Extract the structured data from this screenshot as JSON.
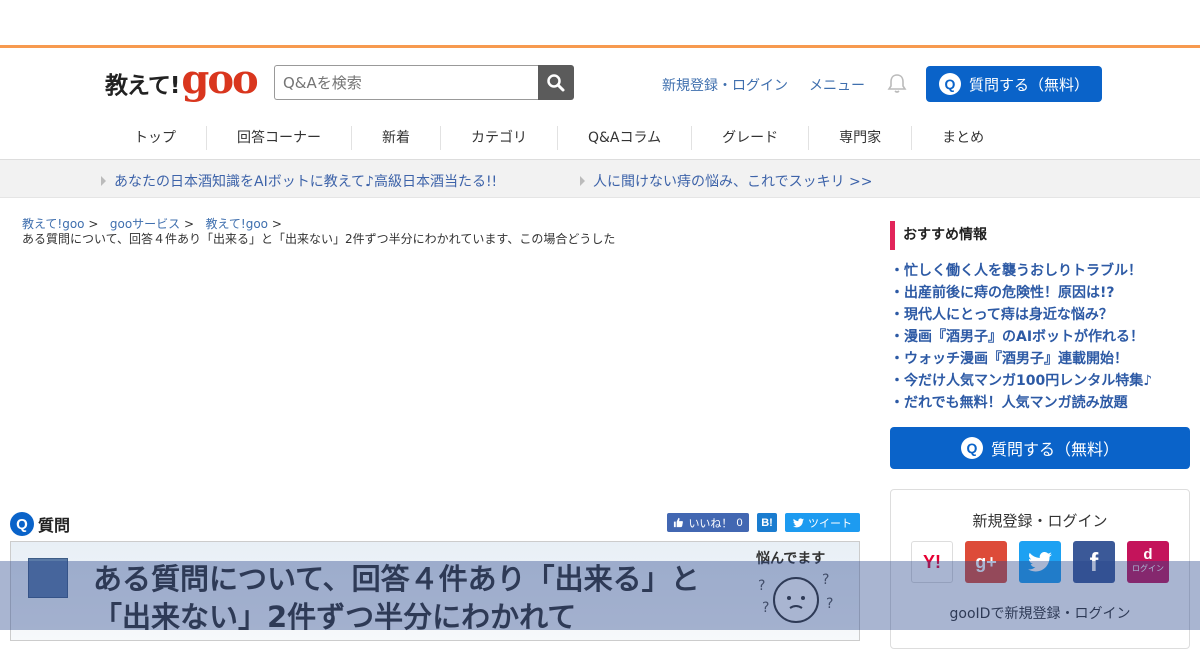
{
  "header": {
    "logo_text": "教えて!",
    "logo_goo": "goo",
    "search_placeholder": "Q&Aを検索",
    "login_link": "新規登録・ログイン",
    "menu_link": "メニュー",
    "ask_button": "質問する（無料）"
  },
  "nav": [
    "トップ",
    "回答コーナー",
    "新着",
    "カテゴリ",
    "Q&Aコラム",
    "グレード",
    "専門家",
    "まとめ"
  ],
  "promo": [
    "あなたの日本酒知識をAIボットに教えて♪高級日本酒当たる!!",
    "人に聞けない痔の悩み、これでスッキリ >>"
  ],
  "breadcrumb": {
    "items": [
      "教えて!goo",
      "gooサービス",
      "教えて!goo"
    ],
    "separator": ">",
    "current": "ある質問について、回答４件あり「出来る」と「出来ない」2件ずつ半分にわかれています、この場合どうした"
  },
  "question": {
    "label": "質問",
    "title": "ある質問について、回答４件あり「出来る」と「出来ない」2件ずつ半分にわかれて",
    "like_label": "いいね！",
    "like_count": "0",
    "hatena_label": "B!",
    "tweet_label": "ツイート",
    "badge_text": "悩んでます"
  },
  "sidebar": {
    "heading": "おすすめ情報",
    "items": [
      "・忙しく働く人を襲うおしりトラブル！",
      "・出産前後に痔の危険性！原因は!?",
      "・現代人にとって痔は身近な悩み？",
      "・漫画『酒男子』のAIボットが作れる！",
      "・ウォッチ漫画『酒男子』連載開始！",
      "・今だけ人気マンガ100円レンタル特集♪",
      "・だれでも無料！人気マンガ読み放題"
    ],
    "ask_button": "質問する（無料）",
    "login_title": "新規登録・ログイン",
    "docomo_label": "ログイン",
    "gooid_text": "gooIDで新規登録・ログイン"
  },
  "colors": {
    "accent": "#0a63c9",
    "topbar_line": "#f79a4f",
    "side_heading_bar": "#e2255a"
  }
}
